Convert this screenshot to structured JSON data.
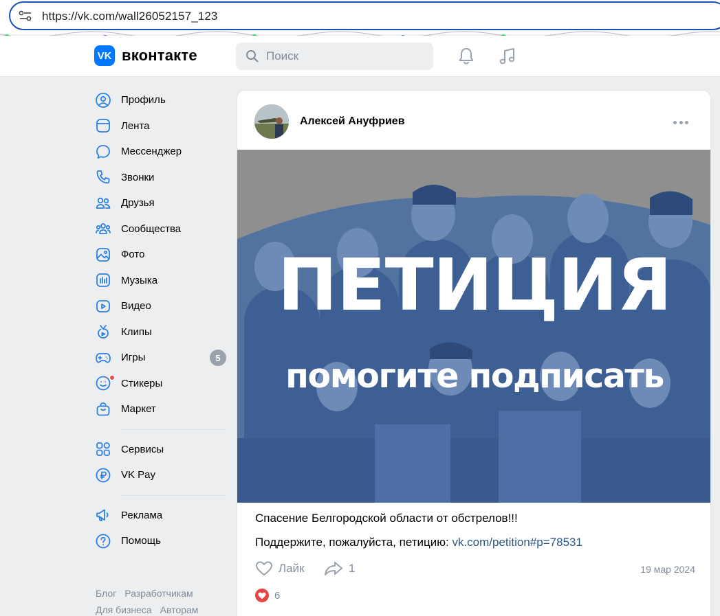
{
  "browser": {
    "url": "https://vk.com/wall26052157_123"
  },
  "header": {
    "logo_mark": "VK",
    "logo_text": "вконтакте",
    "search_placeholder": "Поиск",
    "icons": [
      "bell-icon",
      "music-note-icon"
    ]
  },
  "sidebar": {
    "items": [
      {
        "label": "Профиль",
        "icon": "profile-icon"
      },
      {
        "label": "Лента",
        "icon": "news-icon"
      },
      {
        "label": "Мессенджер",
        "icon": "messenger-icon"
      },
      {
        "label": "Звонки",
        "icon": "phone-icon"
      },
      {
        "label": "Друзья",
        "icon": "friends-icon"
      },
      {
        "label": "Сообщества",
        "icon": "communities-icon"
      },
      {
        "label": "Фото",
        "icon": "photo-icon"
      },
      {
        "label": "Музыка",
        "icon": "music-icon"
      },
      {
        "label": "Видео",
        "icon": "video-icon"
      },
      {
        "label": "Клипы",
        "icon": "clips-icon"
      },
      {
        "label": "Игры",
        "icon": "games-icon",
        "badge": "5"
      },
      {
        "label": "Стикеры",
        "icon": "stickers-icon",
        "dot": true
      },
      {
        "label": "Маркет",
        "icon": "market-icon"
      }
    ],
    "items2": [
      {
        "label": "Сервисы",
        "icon": "services-icon"
      },
      {
        "label": "VK Pay",
        "icon": "vkpay-icon"
      }
    ],
    "items3": [
      {
        "label": "Реклама",
        "icon": "ads-icon"
      },
      {
        "label": "Помощь",
        "icon": "help-icon"
      }
    ],
    "footer": [
      "Блог",
      "Разработчикам",
      "Для бизнеса",
      "Авторам"
    ]
  },
  "post": {
    "author": "Алексей Ануфриев",
    "image_title": "ПЕТИЦИЯ",
    "image_subtitle": "помогите подписать",
    "text_line1": "Спасение Белгородской области от обстрелов!!!",
    "text_line2_prefix": "Поддержите, пожалуйста, петицию: ",
    "text_link": "vk.com/petition#p=78531",
    "like_label": "Лайк",
    "share_count": "1",
    "date": "19 мар 2024",
    "reaction_count": "6"
  },
  "colors": {
    "accent": "#0077ff",
    "link": "#2a5885",
    "secondary_text": "#818c99",
    "badge": "#99a2ad",
    "image_bg": "#8f8f8f",
    "image_people": "#3e5f94"
  }
}
